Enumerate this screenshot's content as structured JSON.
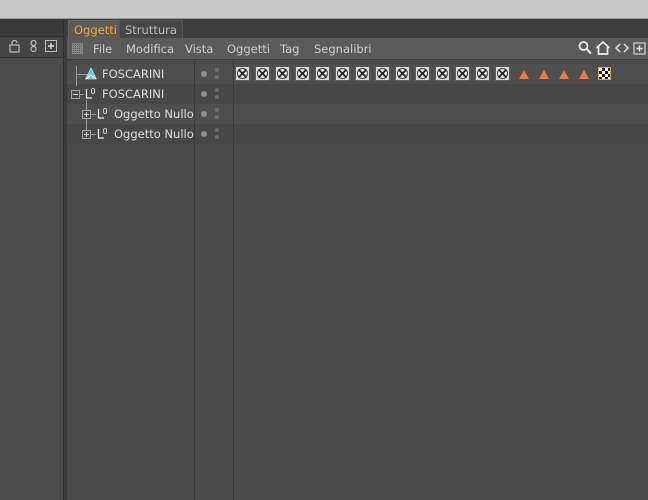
{
  "tabs": [
    {
      "label": "Oggetti",
      "active": true
    },
    {
      "label": "Struttura",
      "active": false
    }
  ],
  "menu": [
    "File",
    "Modifica",
    "Vista",
    "Oggetti",
    "Tag",
    "Segnalibri"
  ],
  "menubar_icons": [
    "search-icon",
    "home-icon",
    "arrows-icon",
    "new-window-icon"
  ],
  "left_toolbar_icons": [
    "lock-icon",
    "link-icon",
    "add-panel-icon"
  ],
  "objects": [
    {
      "name": "FOSCARINI",
      "icon": "camera-target-icon",
      "level": 0,
      "expander": "none"
    },
    {
      "name": "FOSCARINI",
      "icon": "null-object-icon",
      "level": 0,
      "expander": "minus"
    },
    {
      "name": "Oggetto Nullo",
      "icon": "null-object-icon",
      "level": 1,
      "expander": "plus"
    },
    {
      "name": "Oggetto Nullo",
      "icon": "null-object-icon",
      "level": 1,
      "expander": "plus"
    }
  ],
  "first_row_tags": {
    "disabled_tag_count": 14,
    "warning_tag_count": 4,
    "final_tag": "checker-material-tag"
  },
  "colors": {
    "active_tab": "#f5a733",
    "warning_tag": "#f07a3c",
    "camera_icon": "#5ec8f2"
  }
}
